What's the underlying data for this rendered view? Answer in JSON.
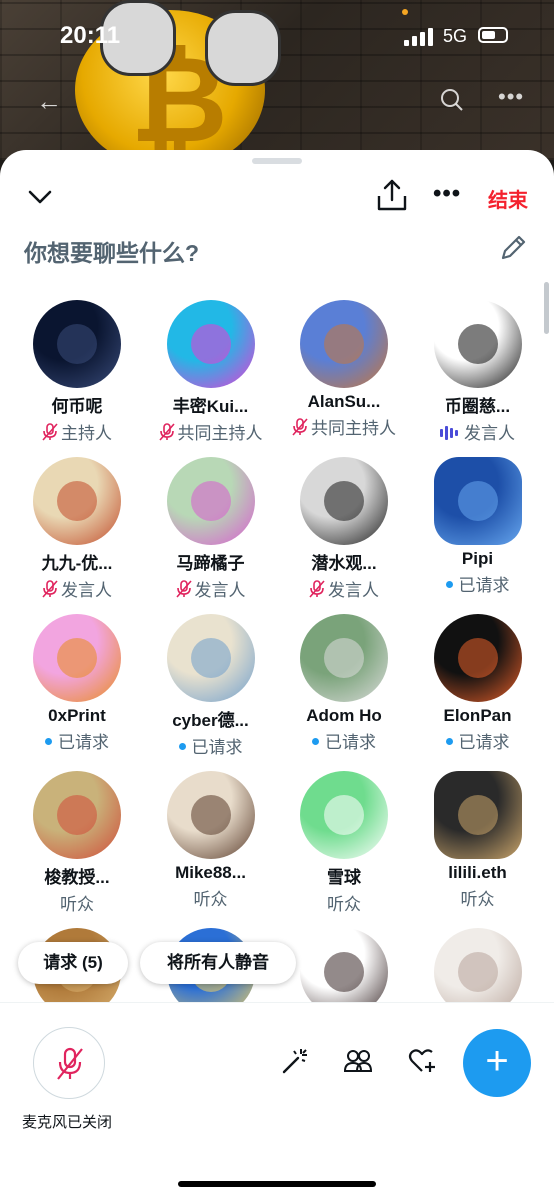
{
  "status_bar": {
    "time": "20:11",
    "network": "5G"
  },
  "header": {
    "end_label": "结束"
  },
  "topic": {
    "text": "你想要聊些什么?"
  },
  "participants": [
    {
      "name": "何币呢",
      "role": "主持人",
      "role_icon": "mic-off",
      "colors": [
        "#0a1530",
        "#3a4c7a"
      ]
    },
    {
      "name": "丰密Kui...",
      "role": "共同主持人",
      "role_icon": "mic-off",
      "colors": [
        "#22b8e6",
        "#e83bd5"
      ]
    },
    {
      "name": "AlanSu...",
      "role": "共同主持人",
      "role_icon": "mic-off",
      "colors": [
        "#5a7fd6",
        "#c8763a"
      ]
    },
    {
      "name": "币圈慈...",
      "role": "发言人",
      "role_icon": "speaking",
      "colors": [
        "#ffffff",
        "#111111"
      ]
    },
    {
      "name": "九九-优...",
      "role": "发言人",
      "role_icon": "mic-off",
      "colors": [
        "#e9d8b4",
        "#c14b2a"
      ]
    },
    {
      "name": "马蹄橘子",
      "role": "发言人",
      "role_icon": "mic-off",
      "colors": [
        "#b8d8b6",
        "#d95bd0"
      ]
    },
    {
      "name": "潜水观...",
      "role": "发言人",
      "role_icon": "mic-off",
      "colors": [
        "#d8d8d8",
        "#1b1b1b"
      ]
    },
    {
      "name": "Pipi",
      "role": "已请求",
      "role_icon": "requested",
      "colors": [
        "#1d4fa8",
        "#66a6ee"
      ]
    },
    {
      "name": "0xPrint",
      "role": "已请求",
      "role_icon": "requested",
      "colors": [
        "#f2a5e0",
        "#e88c1e"
      ]
    },
    {
      "name": "cyber德...",
      "role": "已请求",
      "role_icon": "requested",
      "colors": [
        "#e9e2cf",
        "#6f9ecc"
      ]
    },
    {
      "name": "Adom Ho",
      "role": "已请求",
      "role_icon": "requested",
      "colors": [
        "#7aa37a",
        "#dcdcdc"
      ]
    },
    {
      "name": "ElonPan",
      "role": "已请求",
      "role_icon": "requested",
      "colors": [
        "#111111",
        "#e8602a"
      ]
    },
    {
      "name": "梭教授...",
      "role": "听众",
      "role_icon": "none",
      "colors": [
        "#c9b27a",
        "#d04b38"
      ]
    },
    {
      "name": "Mike88...",
      "role": "听众",
      "role_icon": "none",
      "colors": [
        "#e8dccb",
        "#5a3c2c"
      ]
    },
    {
      "name": "雪球",
      "role": "听众",
      "role_icon": "none",
      "colors": [
        "#6fdc8e",
        "#ffffff"
      ]
    },
    {
      "name": "lilili.eth",
      "role": "听众",
      "role_icon": "none",
      "colors": [
        "#2a2a2a",
        "#c9a46a"
      ]
    },
    {
      "name": "",
      "role": "",
      "role_icon": "none",
      "colors": [
        "#b07a3a",
        "#d8b070"
      ]
    },
    {
      "name": "",
      "role": "",
      "role_icon": "none",
      "colors": [
        "#2b6fd6",
        "#f0d060"
      ]
    },
    {
      "name": "",
      "role": "",
      "role_icon": "none",
      "colors": [
        "#ffffff",
        "#3a2a2a"
      ]
    },
    {
      "name": "",
      "role": "",
      "role_icon": "none",
      "colors": [
        "#f0ece8",
        "#b8a49a"
      ]
    }
  ],
  "actions": {
    "requests_label": "请求 (5)",
    "mute_all_label": "将所有人静音"
  },
  "footer": {
    "mic_label": "麦克风已关闭",
    "fab_label": "+"
  },
  "colors": {
    "accent": "#1d9bf0",
    "danger": "#f4212e",
    "mic_off": "#e0245e",
    "speaking": "#4a4cd8"
  }
}
